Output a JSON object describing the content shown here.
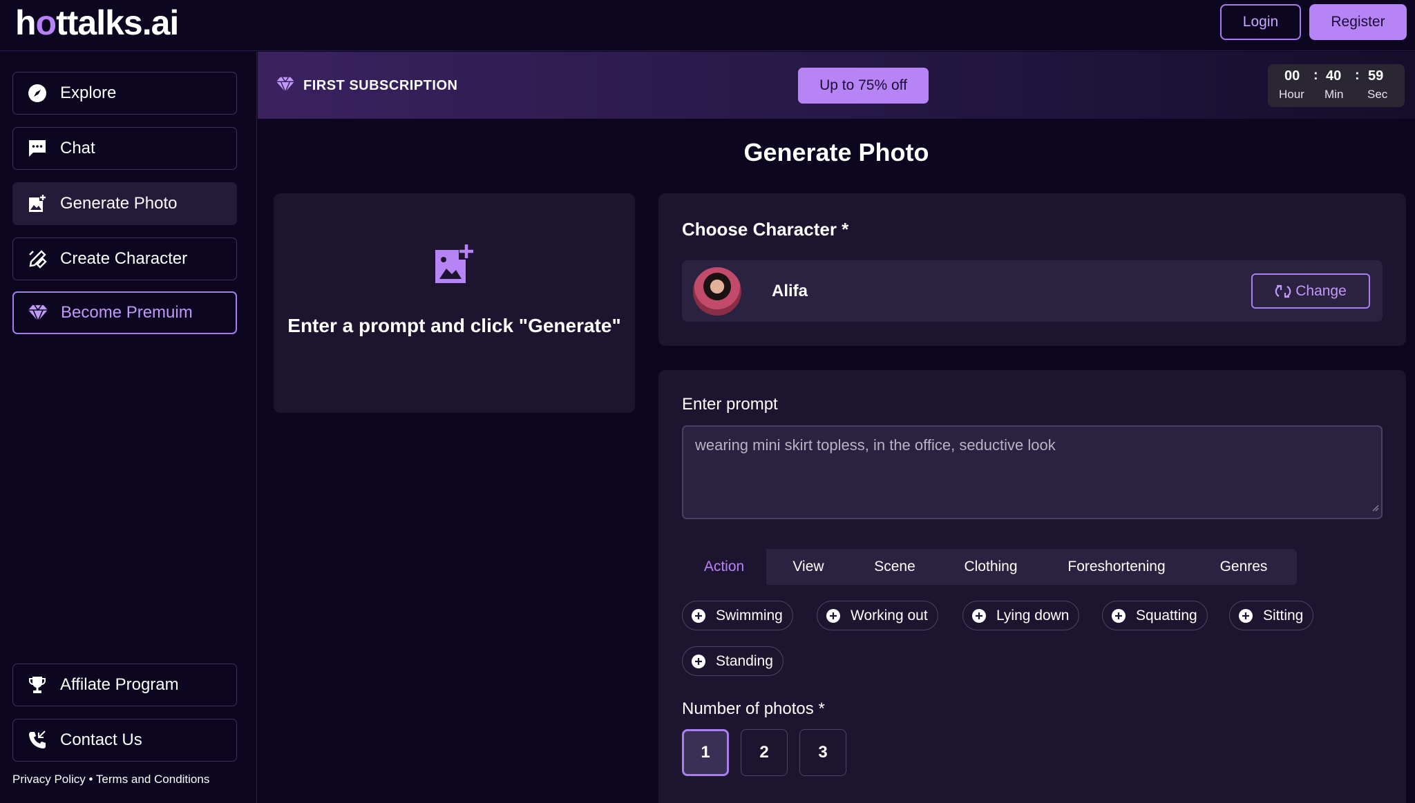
{
  "header": {
    "logo_parts": [
      "h",
      "o",
      "ttalks.ai"
    ],
    "login_label": "Login",
    "register_label": "Register"
  },
  "sidebar": {
    "items": [
      {
        "label": "Explore",
        "icon": "compass-icon"
      },
      {
        "label": "Chat",
        "icon": "chat-bubble-icon"
      },
      {
        "label": "Generate Photo",
        "icon": "add-photo-icon"
      },
      {
        "label": "Create Character",
        "icon": "pencil-ruler-icon"
      },
      {
        "label": "Become Premuim",
        "icon": "diamond-icon"
      }
    ],
    "bottom_items": [
      {
        "label": "Affilate Program",
        "icon": "trophy-icon"
      },
      {
        "label": "Contact Us",
        "icon": "phone-icon"
      }
    ],
    "footer": {
      "privacy": "Privacy Policy",
      "separator": "•",
      "terms": "Terms and Conditions"
    }
  },
  "promo": {
    "title": "FIRST SUBSCRIPTION",
    "cta": "Up to 75% off",
    "timer": {
      "hours": "00",
      "minutes": "40",
      "seconds": "59",
      "hour_label": "Hour",
      "min_label": "Min",
      "sec_label": "Sec",
      "separator": ":"
    }
  },
  "main": {
    "title": "Generate Photo",
    "placeholder_hint": "Enter a prompt and click \"Generate\"",
    "character": {
      "label": "Choose Character *",
      "name": "Alifa",
      "change_label": "Change"
    },
    "prompt": {
      "label": "Enter prompt",
      "value": "wearing mini skirt topless, in the office, seductive look"
    },
    "tabs": [
      "Action",
      "View",
      "Scene",
      "Clothing",
      "Foreshortening",
      "Genres"
    ],
    "active_tab": "Action",
    "chips": [
      "Swimming",
      "Working out",
      "Lying down",
      "Squatting",
      "Sitting",
      "Standing"
    ],
    "photos": {
      "label": "Number of photos *",
      "options": [
        "1",
        "2",
        "3"
      ],
      "selected": "1"
    }
  },
  "colors": {
    "background": "#0c0620",
    "card": "#1d1530",
    "accent": "#b784f5"
  }
}
